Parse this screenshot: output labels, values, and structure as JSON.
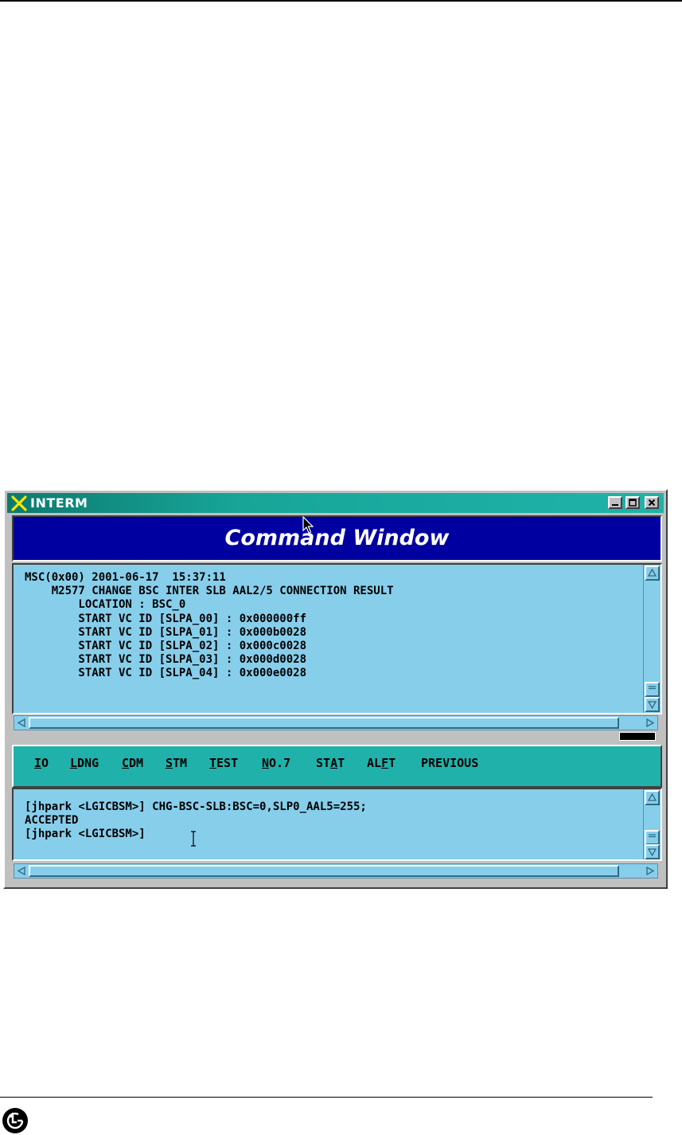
{
  "window": {
    "title": "INTERM",
    "header": "Command Window"
  },
  "output_lines": [
    "MSC(0x00) 2001-06-17  15:37:11",
    "    M2577 CHANGE BSC INTER SLB AAL2/5 CONNECTION RESULT",
    "        LOCATION : BSC_0",
    "        START VC ID [SLPA_00] : 0x000000ff",
    "        START VC ID [SLPA_01] : 0x000b0028",
    "        START VC ID [SLPA_02] : 0x000c0028",
    "        START VC ID [SLPA_03] : 0x000d0028",
    "        START VC ID [SLPA_04] : 0x000e0028"
  ],
  "menu": [
    {
      "pre": "",
      "u": "I",
      "post": "O"
    },
    {
      "pre": "",
      "u": "L",
      "post": "DNG"
    },
    {
      "pre": "",
      "u": "C",
      "post": "DM"
    },
    {
      "pre": "",
      "u": "S",
      "post": "TM"
    },
    {
      "pre": "",
      "u": "T",
      "post": "EST"
    },
    {
      "pre": "",
      "u": "N",
      "post": "O.7"
    },
    {
      "pre": "ST",
      "u": "A",
      "post": "T"
    },
    {
      "pre": "AL",
      "u": "F",
      "post": "T"
    },
    {
      "pre": "PREVIOUS",
      "u": "",
      "post": ""
    }
  ],
  "input_lines": [
    "[jhpark <LGICBSM>] CHG-BSC-SLB:BSC=0,SLP0_AAL5=255;",
    "ACCEPTED",
    "[jhpark <LGICBSM>]"
  ]
}
